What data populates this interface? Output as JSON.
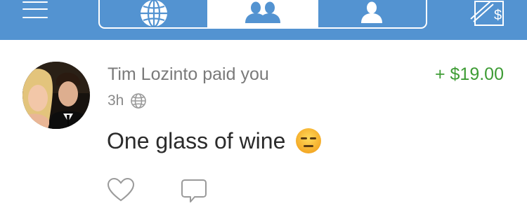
{
  "nav": {
    "menu_icon": "hamburger-menu-icon",
    "tabs": [
      {
        "icon": "globe-icon",
        "active": false
      },
      {
        "icon": "friends-icon",
        "active": true
      },
      {
        "icon": "person-icon",
        "active": false
      }
    ],
    "compose_icon": "pay-or-request-icon"
  },
  "story": {
    "actor": "Tim Lozinto",
    "headline": "Tim Lozinto paid you",
    "amount": "+ $19.00",
    "time": "3h",
    "audience_icon": "globe-icon",
    "note": "One glass of wine",
    "emoji": "expressionless-face-emoji",
    "like_icon": "heart-icon",
    "comment_icon": "comment-bubble-icon"
  },
  "colors": {
    "nav_blue": "#5393d1",
    "amount_green": "#3e9c35",
    "secondary_text": "#7a7a7a",
    "primary_text": "#2b2b2b"
  }
}
